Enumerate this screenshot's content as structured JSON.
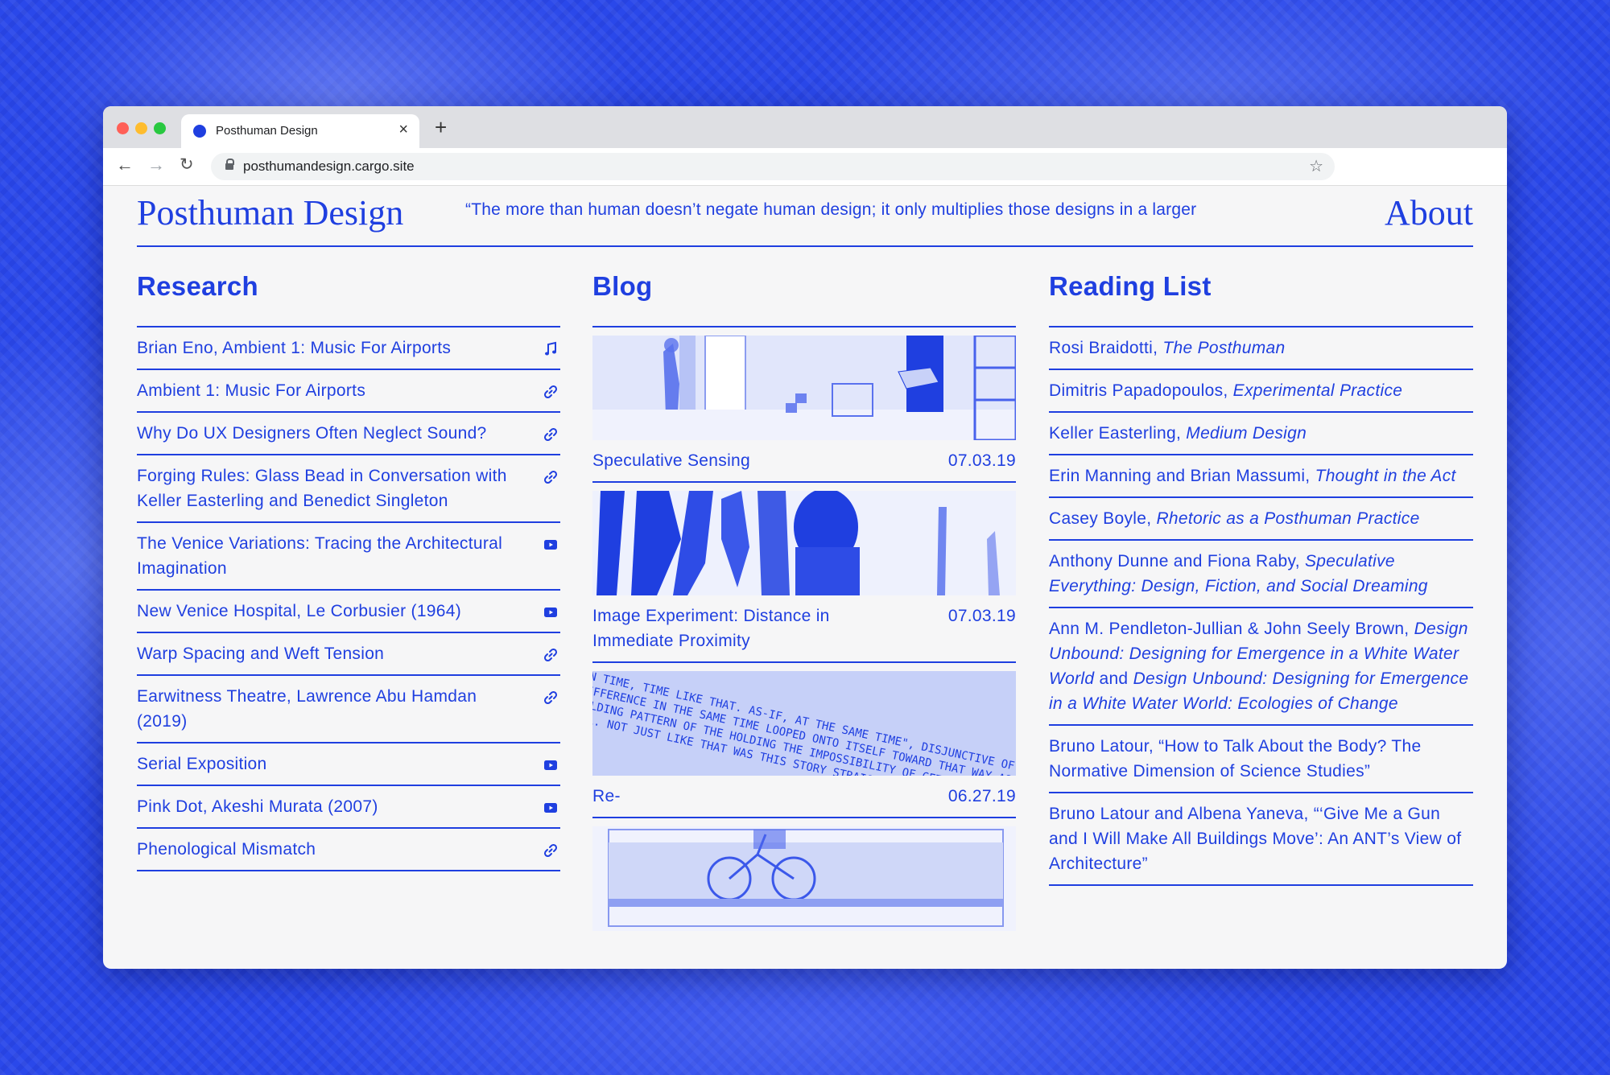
{
  "browser": {
    "tab_title": "Posthuman Design",
    "url": "posthumandesign.cargo.site",
    "new_tab": "+",
    "close": "×"
  },
  "site": {
    "title": "Posthuman Design",
    "quote": "“The more than human doesn’t negate human design; it only multiplies those designs in a larger",
    "about": "About"
  },
  "research": {
    "heading": "Research",
    "items": [
      {
        "label": "Brian Eno, Ambient 1: Music For Airports",
        "icon": "music-note-icon"
      },
      {
        "label": "Ambient 1: Music For Airports",
        "icon": "link-icon"
      },
      {
        "label": "Why Do UX Designers Often Neglect Sound?",
        "icon": "link-icon"
      },
      {
        "label": "Forging Rules: Glass Bead in Conversation with Keller Easterling and Benedict Singleton",
        "icon": "link-icon"
      },
      {
        "label": "The Venice Variations: Tracing the Architectural Imagination",
        "icon": "video-icon"
      },
      {
        "label": "New Venice Hospital, Le Corbusier (1964)",
        "icon": "video-icon"
      },
      {
        "label": "Warp Spacing and Weft Tension",
        "icon": "link-icon"
      },
      {
        "label": "Earwitness Theatre, Lawrence Abu Hamdan (2019)",
        "icon": "link-icon"
      },
      {
        "label": "Serial Exposition",
        "icon": "video-icon"
      },
      {
        "label": "Pink Dot, Akeshi Murata (2007)",
        "icon": "video-icon"
      },
      {
        "label": "Phenological Mismatch",
        "icon": "link-icon"
      }
    ]
  },
  "blog": {
    "heading": "Blog",
    "posts": [
      {
        "title": "Speculative Sensing",
        "date": "07.03.19"
      },
      {
        "title": "Image Experiment: Distance in Immediate Proximity",
        "date": "07.03.19"
      },
      {
        "title": "Re-",
        "date": "06.27.19"
      }
    ],
    "image_text": "IN TIME, TIME LIKE THAT. AS-IF, AT THE SAME TIME\", DISJUNCTIVE OF A DIFFERENCE IN THE SAME TIME LOOPED ONTO ITSELF TOWARD THAT WAY AS HOLDING PATTERN OF THE HOLDING THE IMPOSSIBILITY OF GETTING THE STORY ALL. NOT JUST LIKE THAT WAS THIS STORY STRAIGHT\" IN THIS"
  },
  "reading": {
    "heading": "Reading List",
    "items": [
      {
        "author": "Rosi Braidotti, ",
        "title": "The Posthuman"
      },
      {
        "author": "Dimitris Papadopoulos, ",
        "title": "Experimental Practice"
      },
      {
        "author": "Keller Easterling, ",
        "title": "Medium Design"
      },
      {
        "author": "Erin Manning and Brian Massumi, ",
        "title": "Thought in the Act"
      },
      {
        "author": "Casey Boyle, ",
        "title": "Rhetoric as a Posthuman Practice"
      },
      {
        "author": "Anthony Dunne and Fiona Raby, ",
        "title": "Speculative Everything: Design, Fiction, and Social Dreaming"
      },
      {
        "author": "Ann M. Pendleton-Jullian & John Seely Brown, ",
        "title": "Design Unbound: Designing for Emergence in a White Water World",
        "mid": " and ",
        "title2": "Design Unbound: Designing for Emergence in a White Water World: Ecologies of Change"
      },
      {
        "author": "Bruno Latour, “How to Talk About the Body? The Normative Dimension of Science Studies”",
        "title": ""
      },
      {
        "author": "Bruno Latour and Albena Yaneva, “‘Give Me a Gun and I Will Make All Buildings Move’: An ANT’s View of Architecture”",
        "title": ""
      }
    ]
  },
  "colors": {
    "accent": "#1f3fe0",
    "page_bg": "#f6f6f7",
    "backdrop": "#2a48ea"
  }
}
